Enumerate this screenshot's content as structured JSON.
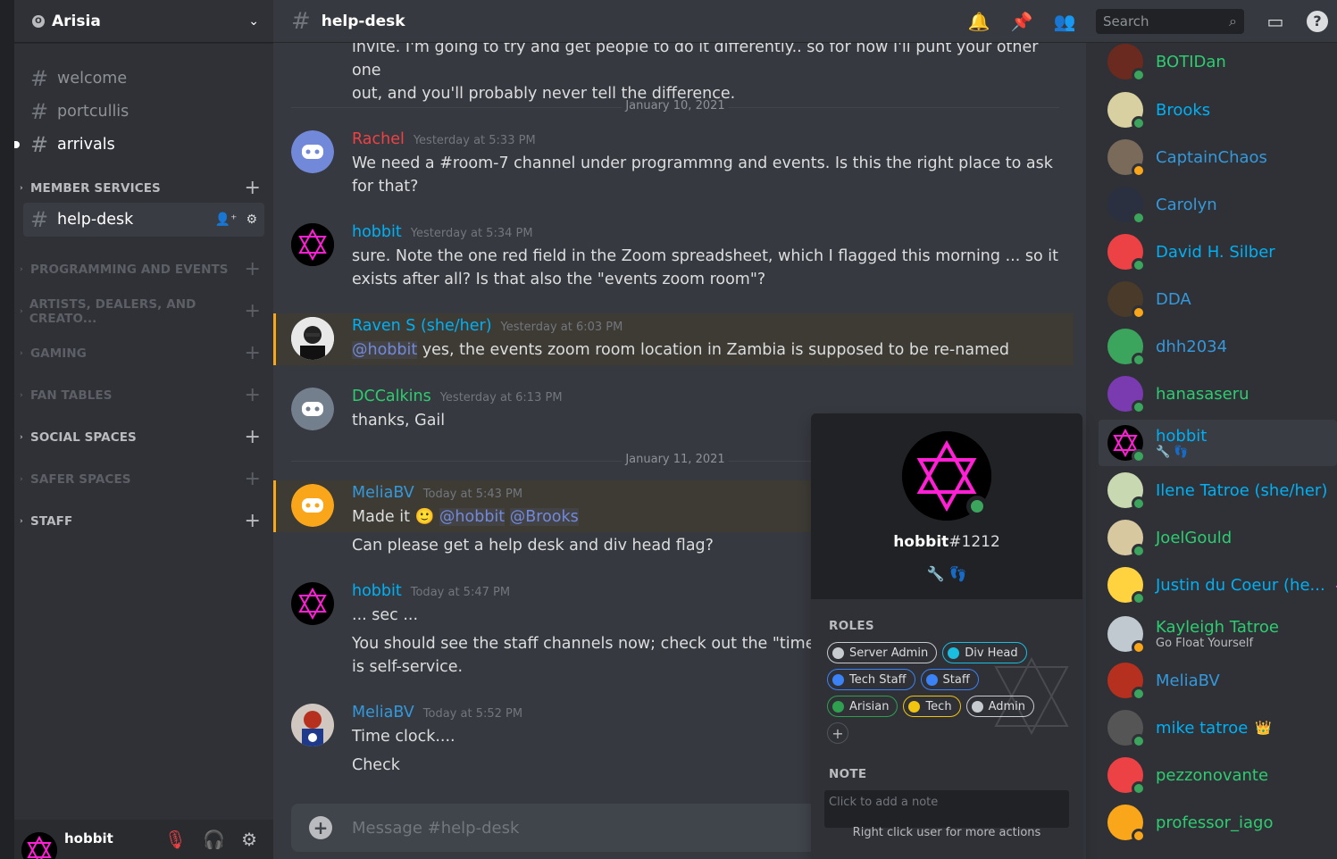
{
  "server": {
    "name": "Arisia",
    "icon": "O"
  },
  "channels": [
    {
      "name": "welcome",
      "state": "normal"
    },
    {
      "name": "portcullis",
      "state": "normal"
    },
    {
      "name": "arrivals",
      "state": "unread"
    }
  ],
  "categories": [
    {
      "name": "MEMBER SERVICES",
      "style": "bright"
    },
    {
      "name": "PROGRAMMING AND EVENTS",
      "style": "muted"
    },
    {
      "name": "ARTISTS, DEALERS, AND CREATO...",
      "style": "muted"
    },
    {
      "name": "GAMING",
      "style": "muted"
    },
    {
      "name": "FAN TABLES",
      "style": "muted"
    },
    {
      "name": "SOCIAL SPACES",
      "style": "bright"
    },
    {
      "name": "SAFER SPACES",
      "style": "muted"
    },
    {
      "name": "STAFF",
      "style": "bright"
    }
  ],
  "active_channel": {
    "name": "help-desk"
  },
  "userbar": {
    "name": "hobbit"
  },
  "topbar": {
    "title": "help-desk",
    "search_placeholder": "Search"
  },
  "chat": {
    "top_partial_line1": "invite.  I'm going to try and get people to do it differently..  so for now I'll punt your other one",
    "top_partial_line2": "out, and you'll probably never tell the difference.",
    "dividers": [
      "January 10, 2021",
      "January 11, 2021"
    ],
    "messages": [
      {
        "author": "Rachel",
        "color": "#ed4245",
        "time": "Yesterday at 5:33 PM",
        "text": "We need a #room-7 channel under programmng and events.  Is this the right place to ask for that?"
      },
      {
        "author": "hobbit",
        "color": "#00b0f4",
        "time": "Yesterday at 5:34 PM",
        "text": "sure.  Note the one red field in the Zoom spreadsheet, which I flagged this morning ... so it exists after all?  Is that also the \"events zoom room\"?"
      },
      {
        "author": "Raven S (she/her)",
        "color": "#00b0f4",
        "time": "Yesterday at 6:03 PM",
        "mention": "@hobbit",
        "text": " yes, the events zoom room location in Zambia is supposed to be re-named"
      },
      {
        "author": "DCCalkins",
        "color": "#2ecc71",
        "time": "Yesterday at 6:13 PM",
        "text": "thanks, Gail"
      },
      {
        "author": "MeliaBV",
        "color": "#3498db",
        "time": "Today at 5:43 PM",
        "text_a": "Made it ",
        "mention_a": "@hobbit",
        "mention_b": "@Brooks",
        "text_b": "Can please get a help desk and div head flag?"
      },
      {
        "author": "hobbit",
        "color": "#00b0f4",
        "time": "Today at 5:47 PM",
        "text_a": "... sec ...",
        "text_b": "You should see the staff channels now; check out the \"time clock",
        "text_c": "is self-service."
      },
      {
        "author": "MeliaBV",
        "color": "#3498db",
        "time": "Today at 5:52 PM",
        "text_a": "Time clock....",
        "text_b": "Check"
      }
    ]
  },
  "composer": {
    "placeholder": "Message #help-desk"
  },
  "members": [
    {
      "name": "BOTIDan",
      "color": "#2ecc71",
      "status": "online"
    },
    {
      "name": "Brooks",
      "color": "#00b0f4",
      "status": "online"
    },
    {
      "name": "CaptainChaos",
      "color": "#3498db",
      "status": "idle"
    },
    {
      "name": "Carolyn",
      "color": "#3498db",
      "status": "online"
    },
    {
      "name": "David H. Silber",
      "color": "#00b0f4",
      "status": "online"
    },
    {
      "name": "DDA",
      "color": "#3498db",
      "status": "idle"
    },
    {
      "name": "dhh2034",
      "color": "#3498db",
      "status": "online"
    },
    {
      "name": "hanasaseru",
      "color": "#2ecc71",
      "status": "online"
    },
    {
      "name": "hobbit",
      "color": "#00b0f4",
      "status": "online",
      "sub": "🔧 👣"
    },
    {
      "name": "Ilene Tatroe (she/her)",
      "color": "#00b0f4",
      "status": "online"
    },
    {
      "name": "JoelGould",
      "color": "#2ecc71",
      "status": "online"
    },
    {
      "name": "Justin du Coeur (he...",
      "color": "#00b0f4",
      "status": "online",
      "badge": "◈"
    },
    {
      "name": "Kayleigh Tatroe",
      "color": "#2ecc71",
      "status": "idle",
      "sub": "Go Float Yourself"
    },
    {
      "name": "MeliaBV",
      "color": "#3498db",
      "status": "online"
    },
    {
      "name": "mike tatroe",
      "color": "#00b0f4",
      "status": "online",
      "badge": "👑"
    },
    {
      "name": "pezzonovante",
      "color": "#2ecc71",
      "status": "online"
    },
    {
      "name": "professor_iago",
      "color": "#2ecc71",
      "status": "idle"
    }
  ],
  "popout": {
    "username": "hobbit",
    "discriminator": "#1212",
    "badges": "🔧 👣",
    "roles_title": "ROLES",
    "roles": [
      {
        "name": "Server Admin",
        "color": "#c7ccd1"
      },
      {
        "name": "Div Head",
        "color": "#1abcdf"
      },
      {
        "name": "Tech Staff",
        "color": "#3b82f6"
      },
      {
        "name": "Staff",
        "color": "#3b82f6"
      },
      {
        "name": "Arisian",
        "color": "#2ea04f"
      },
      {
        "name": "Tech",
        "color": "#f1c40f"
      },
      {
        "name": "Admin",
        "color": "#c7ccd1"
      }
    ],
    "note_title": "NOTE",
    "note_placeholder": "Click to add a note",
    "footer": "Right click user for more actions"
  }
}
